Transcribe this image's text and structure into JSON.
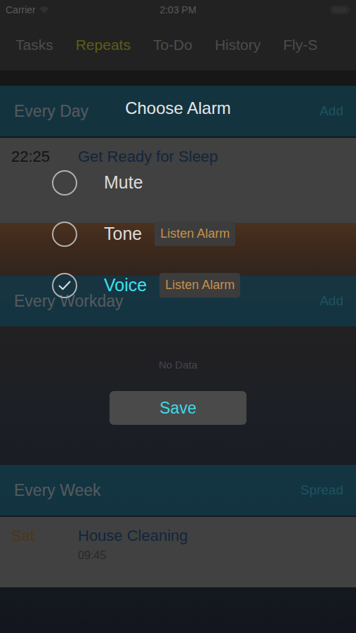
{
  "status_bar": {
    "carrier": "Carrier",
    "time": "2:03 PM"
  },
  "tabs": [
    {
      "label": "Tasks",
      "selected": false
    },
    {
      "label": "Repeats",
      "selected": true
    },
    {
      "label": "To-Do",
      "selected": false
    },
    {
      "label": "History",
      "selected": false
    },
    {
      "label": "Fly-S",
      "selected": false
    }
  ],
  "sections": [
    {
      "title": "Every Day",
      "action": "Add",
      "items": [
        {
          "time": "22:25",
          "title": "Get Ready for Sleep",
          "color": "#333333"
        }
      ]
    },
    {
      "title": "Every Workday",
      "action": "Add",
      "items": [],
      "empty": "No Data"
    },
    {
      "title": "Every Week",
      "action": "Spread",
      "items": [
        {
          "time": "Sat",
          "title": "House Cleaning",
          "subtitle": "09:45",
          "color": "#c08a3e"
        }
      ]
    }
  ],
  "dialog": {
    "title": "Choose Alarm",
    "options": [
      {
        "label": "Mute",
        "selected": false
      },
      {
        "label": "Tone",
        "selected": false,
        "listen": "Listen Alarm"
      },
      {
        "label": "Voice",
        "selected": true,
        "listen": "Listen Alarm"
      }
    ],
    "save": "Save"
  }
}
